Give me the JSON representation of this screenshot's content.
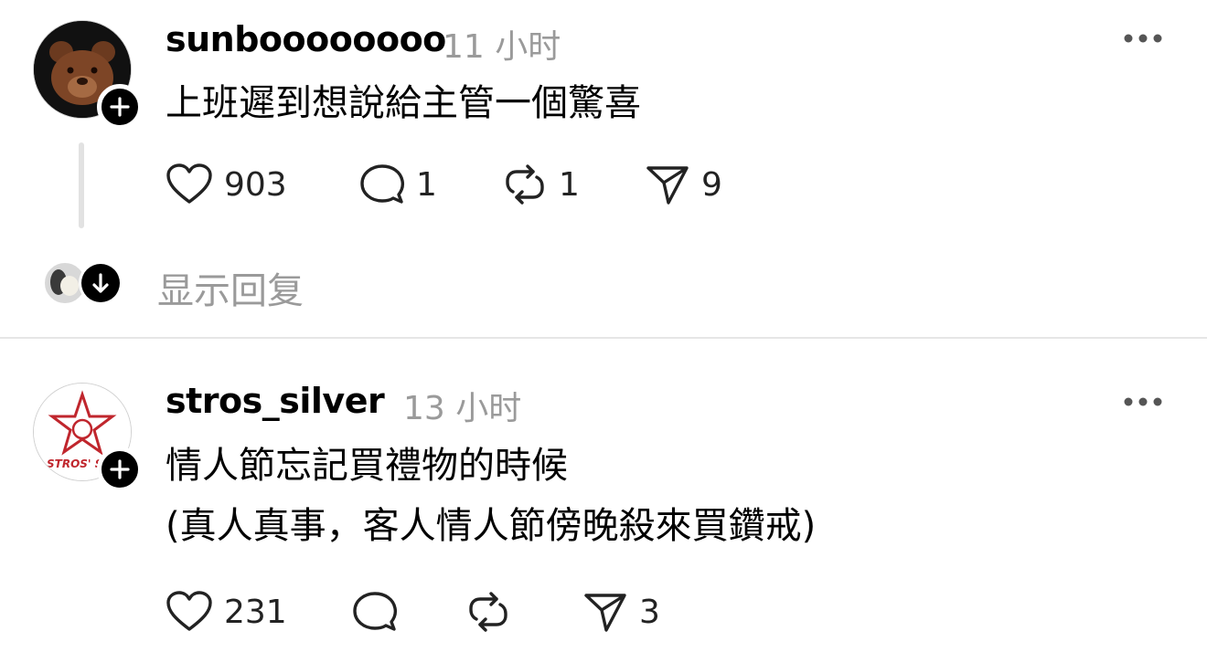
{
  "posts": [
    {
      "username": "sunboooooooo",
      "time": "11 小时",
      "text_lines": [
        "上班遲到想說給主管一個驚喜"
      ],
      "actions": {
        "likes": "903",
        "comments": "1",
        "reposts": "1",
        "shares": "9"
      },
      "avatar_icon": "bear-avatar-icon"
    },
    {
      "username": "stros_silver",
      "time": "13 小时",
      "text_lines": [
        "情人節忘記買禮物的時候",
        "(真人真事，客人情人節傍晚殺來買鑽戒)"
      ],
      "avatar_logo_text": "STROS' S",
      "actions": {
        "likes": "231",
        "comments": "",
        "reposts": "",
        "shares": "3"
      },
      "avatar_icon": "star-logo-avatar-icon"
    }
  ],
  "thread": {
    "show_replies_label": "显示回复"
  },
  "colors": {
    "text": "#000000",
    "muted": "#9a9a9a",
    "divider": "#e6e6e6",
    "logo_red": "#c0262d"
  }
}
